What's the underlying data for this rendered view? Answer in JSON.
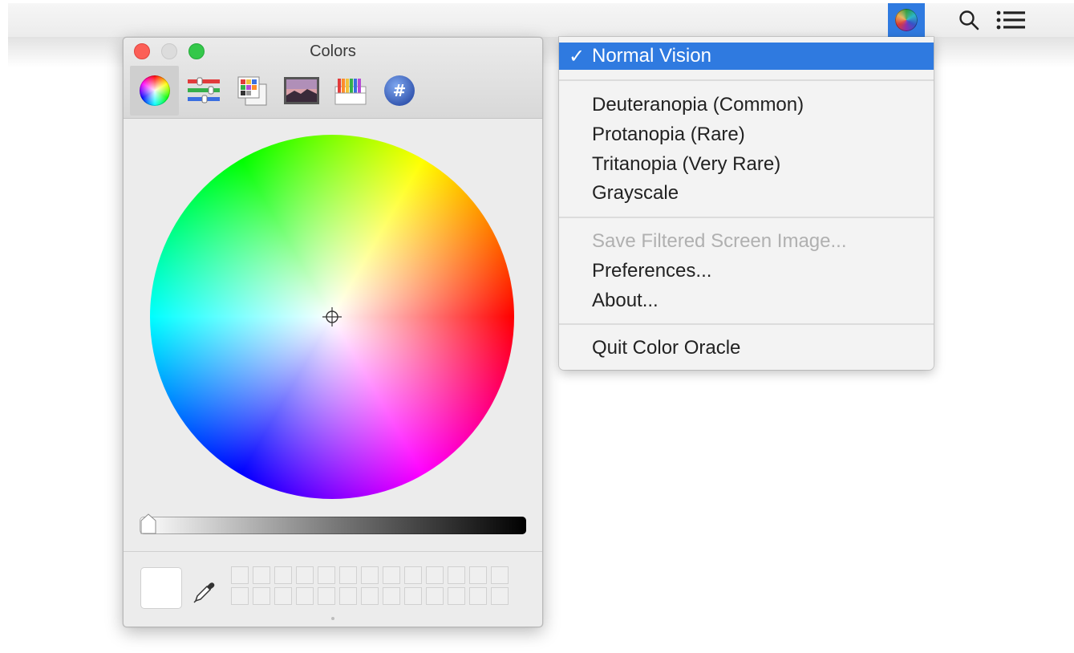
{
  "menubar": {
    "app_icon": "color-oracle-globe-icon",
    "search_icon": "magnifier-icon",
    "list_icon": "list-bullets-icon",
    "accent": "#2f7ae0"
  },
  "colors_window": {
    "title": "Colors",
    "tabs": [
      {
        "icon": "color-wheel-icon",
        "selected": true
      },
      {
        "icon": "color-sliders-icon",
        "selected": false
      },
      {
        "icon": "color-palettes-icon",
        "selected": false
      },
      {
        "icon": "image-palettes-icon",
        "selected": false
      },
      {
        "icon": "pencils-icon",
        "selected": false
      },
      {
        "icon": "hex-code-icon",
        "selected": false
      }
    ],
    "hex_symbol": "#",
    "brightness_level": 1.0,
    "current_color": "#ffffff",
    "swatch_rows": 2,
    "swatch_cols": 13
  },
  "menu": {
    "normal_vision": "Normal Vision",
    "checkmark": "✓",
    "deuteranopia": "Deuteranopia (Common)",
    "protanopia": "Protanopia (Rare)",
    "tritanopia": "Tritanopia (Very Rare)",
    "grayscale": "Grayscale",
    "save_image": "Save Filtered Screen Image...",
    "preferences": "Preferences...",
    "about": "About...",
    "quit": "Quit Color Oracle"
  }
}
